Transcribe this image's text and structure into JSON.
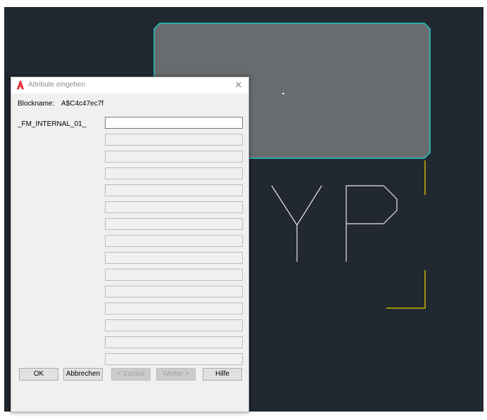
{
  "dialog": {
    "title": "Attribute eingeben",
    "close_glyph": "✕",
    "blockname_label": "Blockname:",
    "blockname_value": "A$C4c47ec7f",
    "attribute_label": "_FM_INTERNAL_01_",
    "fields": [
      "",
      "",
      "",
      "",
      "",
      "",
      "",
      "",
      "",
      "",
      "",
      "",
      "",
      "",
      ""
    ],
    "buttons": {
      "ok": "OK",
      "cancel": "Abbrechen",
      "back": "< Zurück",
      "next": "Weiter >",
      "help": "Hilfe"
    }
  },
  "colors": {
    "canvas_bg": "#212830",
    "selection_cyan": "#1fc7c7",
    "block_fill": "#686c6f",
    "text_lines": "#e6e6e6",
    "corner_marks": "#c8b400",
    "app_icon_red": "#e8262d"
  },
  "icons": {
    "app": "autocad-a-icon",
    "close": "close-icon"
  }
}
